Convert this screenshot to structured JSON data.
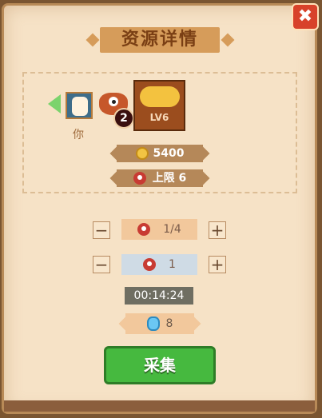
{
  "title": "资源详情",
  "header": {
    "close_label": "✖"
  },
  "owner": {
    "label": "你"
  },
  "monster_team": {
    "count": "2"
  },
  "resource": {
    "level_label": "LV6",
    "amount": "5400",
    "limit_text": "上限 6"
  },
  "steppers": [
    {
      "value": "1/4",
      "minus": "−",
      "plus": "+"
    },
    {
      "value": "1",
      "minus": "−",
      "plus": "+"
    }
  ],
  "timer": "00:14:24",
  "cost": {
    "gems": "8"
  },
  "actions": {
    "collect_label": "采集"
  },
  "colors": {
    "parchment": "#f6e2c6",
    "accent": "#d69c5a",
    "button": "#46b93f"
  },
  "icons": [
    "close-icon",
    "back-arrow-icon",
    "avatar-icon",
    "monster-icon",
    "coin-icon",
    "gem-icon"
  ]
}
